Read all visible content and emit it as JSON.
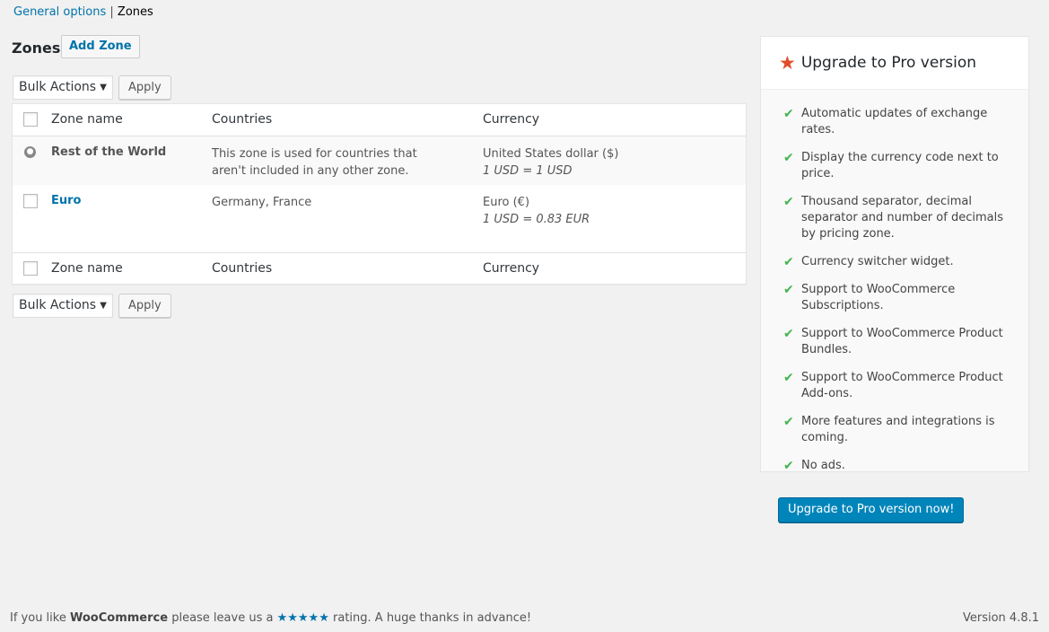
{
  "breadcrumb": {
    "link": "General options",
    "separator": "|",
    "current": "Zones"
  },
  "header": {
    "title": "Zones",
    "add_button": "Add Zone"
  },
  "bulk_actions": {
    "selected": "Bulk Actions",
    "apply": "Apply"
  },
  "table": {
    "columns": [
      "Zone name",
      "Countries",
      "Currency"
    ],
    "rows": [
      {
        "name": "Rest of the World",
        "countries": "This zone is used for countries that aren't included in any other zone.",
        "currency": "United States dollar ($)",
        "rate": "1 USD = 1 USD"
      },
      {
        "name": "Euro",
        "countries": "Germany, France",
        "currency": "Euro (€)",
        "rate": "1 USD = 0.83 EUR"
      }
    ]
  },
  "sidebar": {
    "title": "Upgrade to Pro version",
    "features": [
      "Automatic updates of exchange rates.",
      "Display the currency code next to price.",
      "Thousand separator, decimal separator and number of decimals by pricing zone.",
      "Currency switcher widget.",
      "Support to WooCommerce Subscriptions.",
      "Support to WooCommerce Product Bundles.",
      "Support to WooCommerce Product Add-ons.",
      "More features and integrations is coming.",
      "No ads."
    ],
    "cta": "Upgrade to Pro version now!"
  },
  "footer": {
    "prefix": "If you like",
    "brand": "WooCommerce",
    "middle": "please leave us a",
    "stars": "★★★★★",
    "suffix": "rating. A huge thanks in advance!",
    "version": "Version 4.8.1"
  },
  "colors": {
    "link": "#0073aa",
    "primary_button": "#0085ba",
    "check": "#46b450",
    "star": "#e14d2a"
  }
}
